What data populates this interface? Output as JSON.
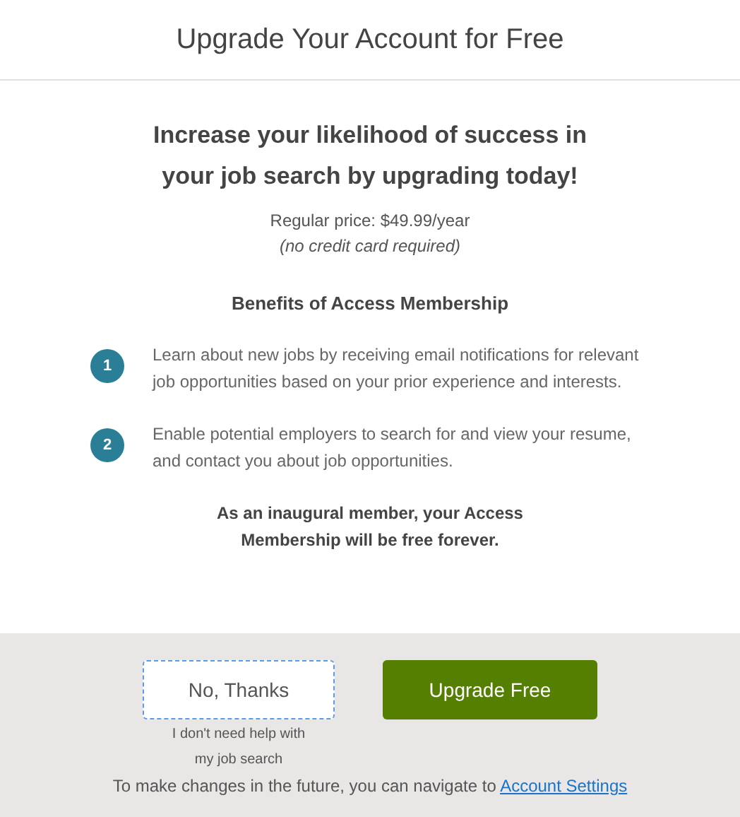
{
  "dialog": {
    "title": "Upgrade Your Account for Free"
  },
  "headline": [
    "Increase your likelihood of success in",
    "your job search by upgrading today!"
  ],
  "price": "Regular price: $49.99/year",
  "price_note": "(no credit card required)",
  "benefits": {
    "title": "Benefits of Access Membership",
    "items": [
      {
        "number": "1",
        "text": "Learn about new jobs by receiving email notifications for relevant job opportunities based on your prior experience and interests."
      },
      {
        "number": "2",
        "text": "Enable potential employers to search for and view your resume, and contact you about job opportunities."
      }
    ]
  },
  "closing_note": [
    "As an inaugural member, your Access",
    "Membership will be free forever."
  ],
  "decline_button": {
    "label": "No, Thanks",
    "focused": true,
    "hint": [
      "I don't need help with",
      "my job search"
    ]
  },
  "upgrade_button": {
    "label": "Upgrade Free"
  },
  "footer": {
    "text": "To make changes in the future, you can navigate to",
    "link": "Account Settings"
  }
}
